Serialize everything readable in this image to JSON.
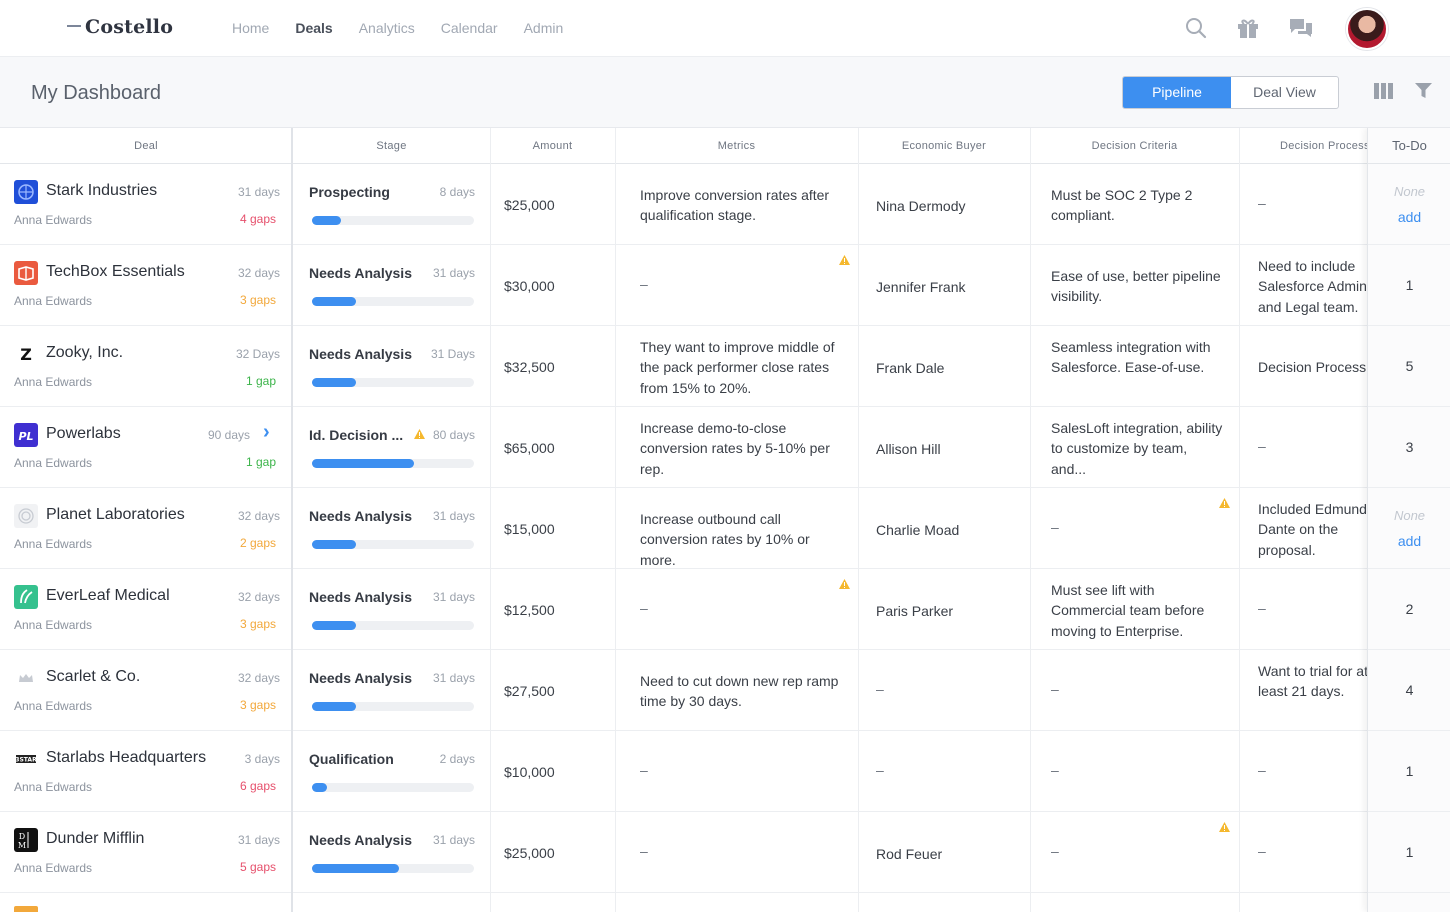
{
  "nav": {
    "brand": "Costello",
    "links": [
      "Home",
      "Deals",
      "Analytics",
      "Calendar",
      "Admin"
    ],
    "active": "Deals"
  },
  "header": {
    "title": "My Dashboard",
    "toggle": [
      "Pipeline",
      "Deal View"
    ],
    "toggle_active": "Pipeline"
  },
  "columns": {
    "deal": "Deal",
    "stage": "Stage",
    "amount": "Amount",
    "metrics": "Metrics",
    "buyer": "Economic Buyer",
    "criteria": "Decision Criteria",
    "process": "Decision Process",
    "todo": "To-Do"
  },
  "colors": {
    "accent": "#3d8ff0",
    "gap_red": "#e6506c",
    "gap_orange": "#f2a83b",
    "gap_green": "#3cb44a",
    "warn": "#f5b82e"
  },
  "rows": [
    {
      "name": "Stark Industries",
      "days": "31 days",
      "owner": "Anna Edwards",
      "gaps": "4 gaps",
      "gap_color": "#e6506c",
      "stage": "Prospecting",
      "stage_days": "8 days",
      "progress": 0.18,
      "amount": "$25,000",
      "metrics": "Improve conversion rates after qualification stage.",
      "buyer": "Nina Dermody",
      "criteria": "Must be SOC 2 Type 2 compliant.",
      "process": "–",
      "todo_none": "None",
      "todo_add": "add"
    },
    {
      "name": "TechBox Essentials",
      "days": "32 days",
      "owner": "Anna Edwards",
      "gaps": "3 gaps",
      "gap_color": "#f2a83b",
      "stage": "Needs Analysis",
      "stage_days": "31 days",
      "progress": 0.27,
      "amount": "$30,000",
      "metrics": "–",
      "buyer": "Jennifer Frank",
      "criteria": "Ease of use, better pipeline visibility.",
      "process": "Need to include Salesforce Admin and Legal team.",
      "todo": "1"
    },
    {
      "name": "Zooky, Inc.",
      "days": "32 Days",
      "owner": "Anna Edwards",
      "gaps": "1 gap",
      "gap_color": "#3cb44a",
      "stage": "Needs Analysis",
      "stage_days": "31 Days",
      "progress": 0.27,
      "amount": "$32,500",
      "metrics": "They want to improve middle of the pack performer close rates from 15% to 20%.",
      "buyer": "Frank Dale",
      "criteria": "Seamless integration with Salesforce. Ease-of-use.",
      "process": "Decision Process",
      "todo": "5"
    },
    {
      "name": "Powerlabs",
      "days": "90 days",
      "owner": "Anna Edwards",
      "gaps": "1 gap",
      "gap_color": "#3cb44a",
      "stage": "Id. Decision ...",
      "stage_days": "80 days",
      "progress": 0.63,
      "amount": "$65,000",
      "metrics": "Increase demo-to-close conversion rates by 5-10% per rep.",
      "buyer": "Allison Hill",
      "criteria": "SalesLoft integration, ability to customize by team, and...",
      "process": "–",
      "todo": "3"
    },
    {
      "name": "Planet Laboratories",
      "days": "32 days",
      "owner": "Anna Edwards",
      "gaps": "2 gaps",
      "gap_color": "#f2a83b",
      "stage": "Needs Analysis",
      "stage_days": "31 days",
      "progress": 0.27,
      "amount": "$15,000",
      "metrics": "Increase outbound call conversion rates by 10% or more.",
      "buyer": "Charlie Moad",
      "criteria": "–",
      "process": "Included Edmund Dante on the proposal.",
      "todo_none": "None",
      "todo_add": "add"
    },
    {
      "name": "EverLeaf Medical",
      "days": "32 days",
      "owner": "Anna Edwards",
      "gaps": "3 gaps",
      "gap_color": "#f2a83b",
      "stage": "Needs Analysis",
      "stage_days": "31 days",
      "progress": 0.27,
      "amount": "$12,500",
      "metrics": "–",
      "buyer": "Paris Parker",
      "criteria": "Must see lift with Commercial team before moving to Enterprise.",
      "process": "–",
      "todo": "2"
    },
    {
      "name": "Scarlet & Co.",
      "days": "32 days",
      "owner": "Anna Edwards",
      "gaps": "3 gaps",
      "gap_color": "#f2a83b",
      "stage": "Needs Analysis",
      "stage_days": "31 days",
      "progress": 0.27,
      "amount": "$27,500",
      "metrics": "Need to cut down new rep ramp time by 30 days.",
      "buyer": "–",
      "criteria": "–",
      "process": "Want to trial for at least 21 days.",
      "todo": "4"
    },
    {
      "name": "Starlabs Headquarters",
      "days": "3 days",
      "owner": "Anna Edwards",
      "gaps": "6 gaps",
      "gap_color": "#e6506c",
      "stage": "Qualification",
      "stage_days": "2 days",
      "progress": 0.09,
      "amount": "$10,000",
      "metrics": "–",
      "buyer": "–",
      "criteria": "–",
      "process": "–",
      "todo": "1"
    },
    {
      "name": "Dunder Mifflin",
      "days": "31 days",
      "owner": "Anna Edwards",
      "gaps": "5 gaps",
      "gap_color": "#e6506c",
      "stage": "Needs Analysis",
      "stage_days": "31 days",
      "progress": 0.54,
      "amount": "$25,000",
      "metrics": "–",
      "buyer": "Rod Feuer",
      "criteria": "–",
      "process": "–",
      "todo": "1"
    }
  ]
}
